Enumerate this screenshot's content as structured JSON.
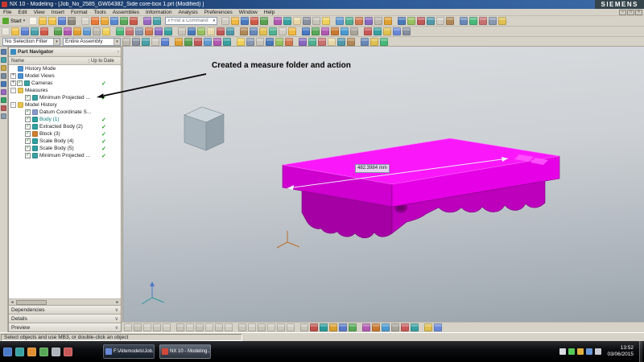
{
  "title_bar": {
    "title": "NX 10 - Modeling - [Job_No_2585_GW04382_Side core-box 1.prt (Modified) ]",
    "brand": "SIEMENS"
  },
  "menu_bar": {
    "items": [
      "File",
      "Edit",
      "View",
      "Insert",
      "Format",
      "Tools",
      "Assemblies",
      "Information",
      "Analysis",
      "Preferences",
      "Window",
      "Help"
    ]
  },
  "window_controls": [
    "–",
    "□",
    "×"
  ],
  "toolbars": {
    "start_label": "Start",
    "find_placeholder": "Find a Command",
    "row1a": [
      "#f7f3e8",
      "#f0c24a",
      "#f0c24a",
      "#5a7fd0",
      "#8a867c",
      "#d8d4ca",
      "#e87838",
      "#e8a838",
      "#5888d0",
      "#58a858",
      "#c8584a",
      "#9868c0",
      "#48a0a8"
    ],
    "row1b": [
      "#d0ccc2",
      "#f0b840",
      "#4878c0",
      "#d05848",
      "#58a050",
      "#b058b0",
      "#38a0a0",
      "#e8d8a8",
      "#8890a0",
      "#c8c4ba",
      "#f0d058",
      "#6098d0",
      "#50b090",
      "#d07850",
      "#8868c0",
      "#bcb8ae",
      "#e0a030",
      "#4878b8",
      "#98c060",
      "#c05858",
      "#5098a8",
      "#d0ccc2",
      "#b08858",
      "#6888b8",
      "#48b878",
      "#c87070",
      "#8898b0",
      "#e0c050"
    ],
    "row2": [
      "#e8e4da",
      "#f0c24a",
      "#5a7fd0",
      "#48a0a8",
      "#d05848",
      "#58a050",
      "#b058b0",
      "#e0a030",
      "#6098d0",
      "#bcb8ae",
      "#f0d058",
      "#48b878",
      "#c87070",
      "#8898b0",
      "#d07850",
      "#8868c0",
      "#38a0a0",
      "#c8c4ba",
      "#4878b8",
      "#98c060",
      "#e8d8a8",
      "#c05858",
      "#5098a8",
      "#b08858",
      "#6888b8",
      "#e0c050",
      "#50b090",
      "#d0ccc2",
      "#f0b840",
      "#4878c0",
      "#58a858",
      "#b05ab0",
      "#c87830",
      "#4a9ad0",
      "#a8a49a",
      "#c85858",
      "#38a0a0",
      "#e0c050",
      "#6a88d8",
      "#8890a0"
    ],
    "selbar_icons": [
      "#bcb8ae",
      "#8890a0",
      "#48a0a8",
      "#d0ccc2",
      "#5a7fd0",
      "#e0a030",
      "#58a050",
      "#c05858",
      "#6098d0",
      "#b058b0",
      "#38a0a0",
      "#f0d058",
      "#8898b0",
      "#c8c4ba",
      "#4878b8",
      "#98c060",
      "#d07850",
      "#8868c0",
      "#50b090",
      "#c87070",
      "#e8d8a8",
      "#5098a8",
      "#b08858",
      "#6888b8",
      "#e0c050",
      "#48b878"
    ],
    "bottom": [
      "#cfccc2",
      "#c6c2b8",
      "#d2cec4",
      "#cac6bc",
      "#d0ccc2",
      "#c8c4ba",
      "#cfccc2",
      "#c6c2b8",
      "#d2cec4",
      "#cac6bc",
      "#d0ccc2",
      "#c8c4ba",
      "#cfccc2",
      "#c6c2b8",
      "#d2cec4",
      "#cac6bc",
      "#d0ccc2",
      "#c8c4ba",
      "#c0504a",
      "#2a9a9a",
      "#d8a030",
      "#5878c8",
      "#58a858",
      "#b05ab0",
      "#c87830",
      "#4a9ad0",
      "#a8a49a",
      "#c85858",
      "#38a0a0",
      "#e0c050",
      "#6a88d8"
    ]
  },
  "selection_bar": {
    "filter_value": "No Selection Filter",
    "scope_value": "Entire Assembly"
  },
  "resource_bar": {
    "icons": [
      "#5a7fae",
      "#48a0a8",
      "#c8a84a",
      "#7a8a9a",
      "#4878b8",
      "#9868c0",
      "#38a06a",
      "#b85a5a",
      "#8a9aaa"
    ]
  },
  "part_navigator": {
    "title": "Part Navigator",
    "columns": [
      "Name",
      "Up to Date"
    ],
    "items": [
      {
        "cls": "lvl0",
        "exp": "",
        "label": "History Mode",
        "ic": "#4a90d0",
        "chk": ""
      },
      {
        "cls": "lvl0",
        "exp": "+",
        "label": "Model Views",
        "ic": "#4a90d0",
        "chk": ""
      },
      {
        "cls": "lvl0 has-cb",
        "exp": "+",
        "label": "Cameras",
        "ic": "#3aa0a0",
        "chk": "✓"
      },
      {
        "cls": "lvl0",
        "exp": "-",
        "label": "Measures",
        "ic": "#e8c44a",
        "chk": ""
      },
      {
        "cls": "lvl1 has-cb",
        "exp": "",
        "label": "Minimum Projected ...",
        "ic": "#3aa0a0",
        "chk": "✓"
      },
      {
        "cls": "lvl0",
        "exp": "-",
        "label": "Model History",
        "ic": "#e8c44a",
        "chk": ""
      },
      {
        "cls": "lvl1 has-cb",
        "exp": "",
        "label": "Datum Coordinate S...",
        "ic": "#8899cc",
        "chk": ""
      },
      {
        "cls": "lvl1 has-cb em",
        "exp": "",
        "label": "Body (1)",
        "ic": "#30a0a0",
        "chk": "✓"
      },
      {
        "cls": "lvl1 has-cb",
        "exp": "",
        "label": "Extracted Body (2)",
        "ic": "#30a0a0",
        "chk": "✓"
      },
      {
        "cls": "lvl1 has-cb",
        "exp": "",
        "label": "Block (3)",
        "ic": "#d08030",
        "chk": "✓"
      },
      {
        "cls": "lvl1 has-cb",
        "exp": "",
        "label": "Scale Body (4)",
        "ic": "#30a0a0",
        "chk": "✓"
      },
      {
        "cls": "lvl1 has-cb",
        "exp": "",
        "label": "Scale Body (5)",
        "ic": "#30a0a0",
        "chk": "✓"
      },
      {
        "cls": "lvl1 has-cb",
        "exp": "",
        "label": "Minimum Projected ...",
        "ic": "#3aa0a0",
        "chk": "✓"
      }
    ],
    "sections": [
      {
        "label": "Dependencies"
      },
      {
        "label": "Details"
      },
      {
        "label": "Preview"
      }
    ]
  },
  "viewport": {
    "annotation": "Created a measure folder and action",
    "dimension_label": "482.3984 mm",
    "part_color": "#fa18fa",
    "cube_color": "#ccd5d9"
  },
  "status_bar": {
    "message": "Select objects and use MB3, or double-click an object"
  },
  "taskbar": {
    "quick_launch": [
      "#4a7ac8",
      "#38a0a0",
      "#e09030",
      "#58a858",
      "#b0b4bc",
      "#c85858"
    ],
    "buttons": [
      {
        "label": "F:\\Altemodels\\Job...",
        "c": "#6a8ad8",
        "cls": ""
      },
      {
        "label": "NX 10 - Modeling...",
        "c": "#d04a3a",
        "cls": "active"
      }
    ],
    "tray_icons": [
      "#d8dce2",
      "#58c858",
      "#e0b040",
      "#6898d8",
      "#c8ccd2"
    ],
    "time": "13:52",
    "date": "03/06/2015"
  }
}
